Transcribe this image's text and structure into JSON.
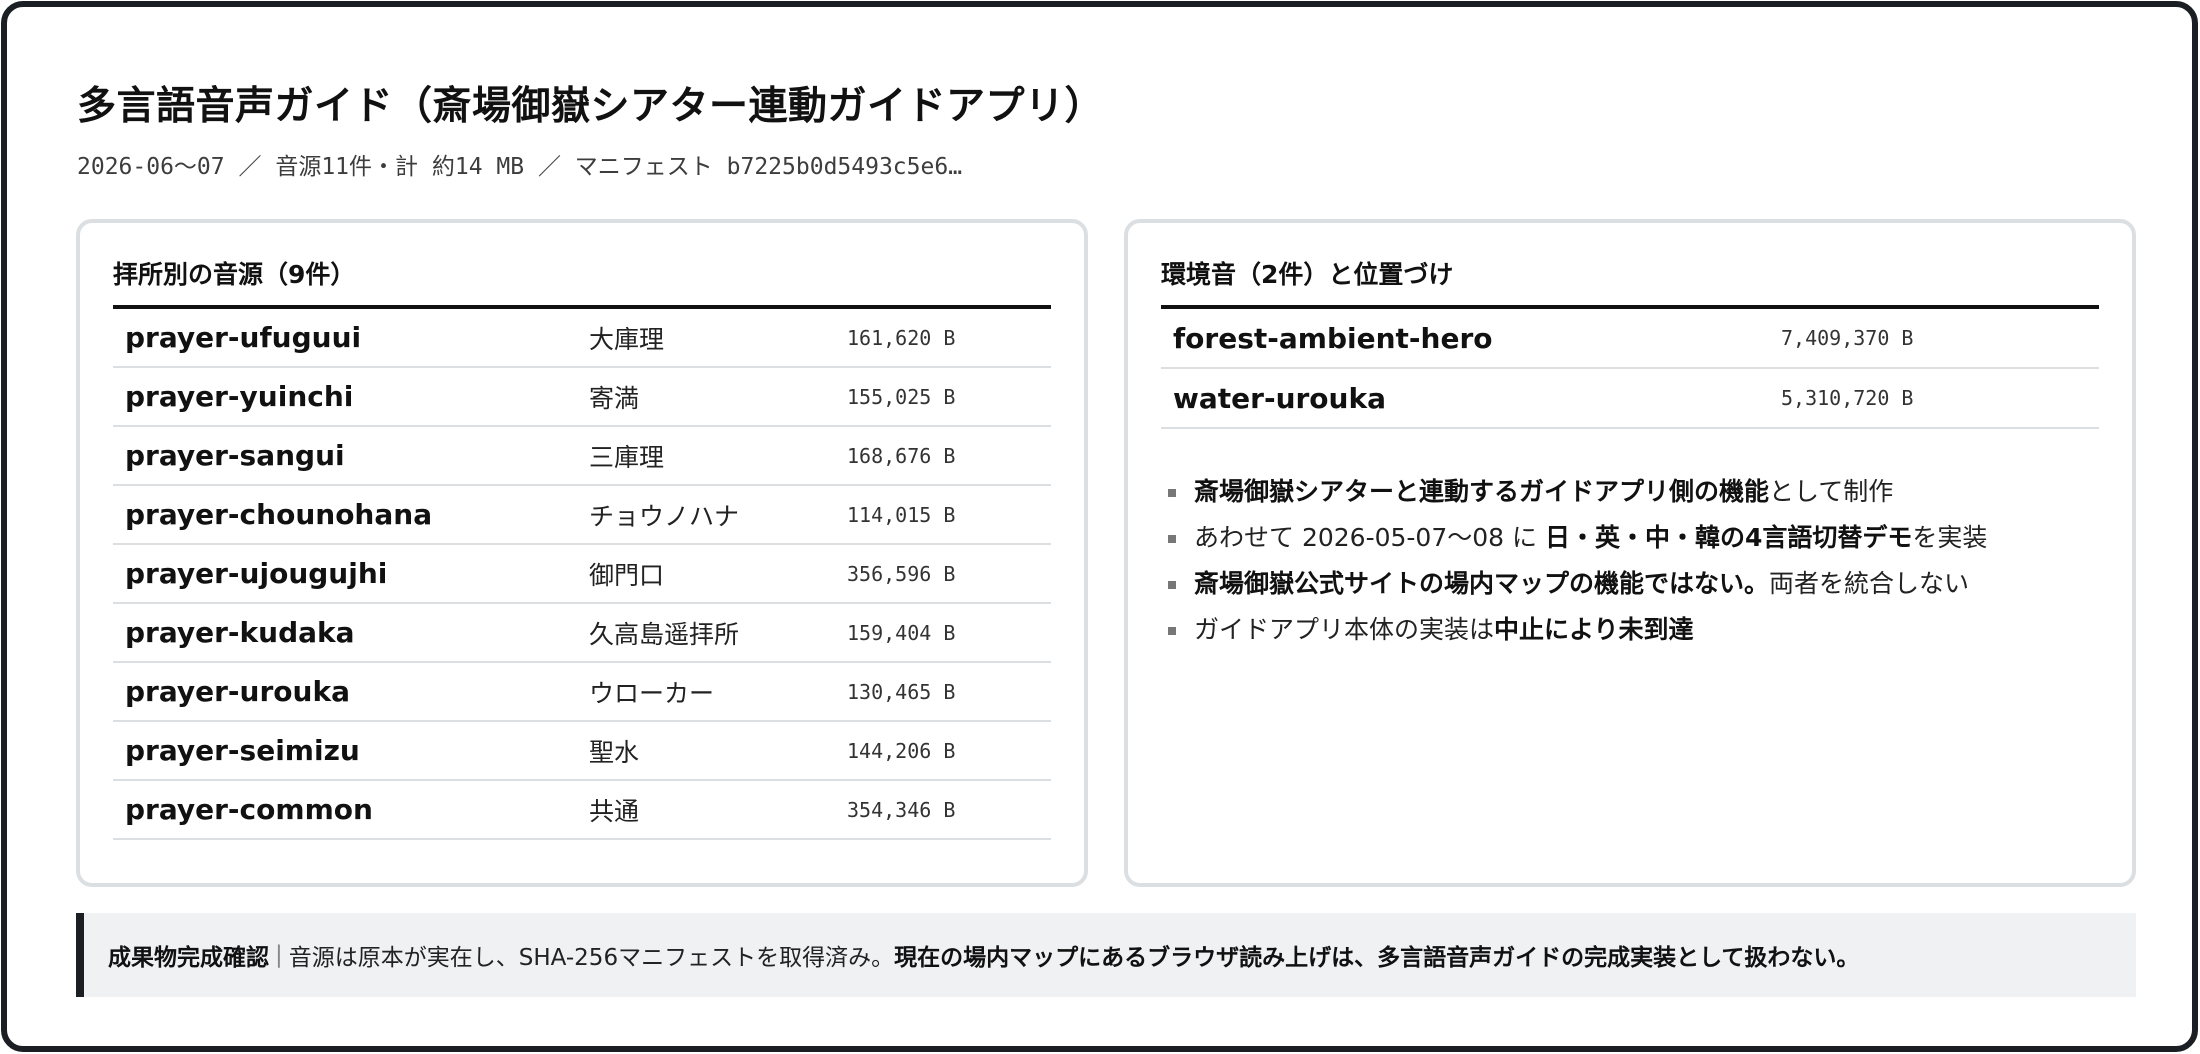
{
  "page": {
    "title": "多言語音声ガイド（斎場御嶽シアター連動ガイドアプリ）",
    "meta": "2026-06〜07 ／ 音源11件・計 約14 MB ／ マニフェスト b7225b0d5493c5e6…"
  },
  "left_panel": {
    "title": "拝所別の音源（9件）",
    "rows": [
      {
        "id": "prayer-ufuguui",
        "name": "大庫理",
        "size": "161,620 B"
      },
      {
        "id": "prayer-yuinchi",
        "name": "寄満",
        "size": "155,025 B"
      },
      {
        "id": "prayer-sangui",
        "name": "三庫理",
        "size": "168,676 B"
      },
      {
        "id": "prayer-chounohana",
        "name": "チョウノハナ",
        "size": "114,015 B"
      },
      {
        "id": "prayer-ujougujhi",
        "name": "御門口",
        "size": "356,596 B"
      },
      {
        "id": "prayer-kudaka",
        "name": "久高島遥拝所",
        "size": "159,404 B"
      },
      {
        "id": "prayer-urouka",
        "name": "ウローカー",
        "size": "130,465 B"
      },
      {
        "id": "prayer-seimizu",
        "name": "聖水",
        "size": "144,206 B"
      },
      {
        "id": "prayer-common",
        "name": "共通",
        "size": "354,346 B"
      }
    ]
  },
  "right_panel": {
    "title": "環境音（2件）と位置づけ",
    "rows": [
      {
        "id": "forest-ambient-hero",
        "size": "7,409,370 B"
      },
      {
        "id": "water-urouka",
        "size": "5,310,720 B"
      }
    ],
    "notes": [
      {
        "bold_a": "斎場御嶽シアターと連動するガイドアプリ側の機能",
        "text_a": "として制作"
      },
      {
        "text_a": "あわせて 2026-05-07〜08 に ",
        "bold_a": "日・英・中・韓の4言語切替デモ",
        "text_b": "を実装"
      },
      {
        "bold_a": "斎場御嶽公式サイトの場内マップの機能ではない。",
        "text_a": "両者を統合しない"
      },
      {
        "text_a": "ガイドアプリ本体の実装は",
        "bold_a": "中止により未到達"
      }
    ]
  },
  "confirmation": {
    "label": "成果物完成確認",
    "separator": "|",
    "text": "音源は原本が実在し、SHA-256マニフェストを取得済み。",
    "strong": "現在の場内マップにあるブラウザ読み上げは、多言語音声ガイドの完成実装として扱わない。"
  }
}
